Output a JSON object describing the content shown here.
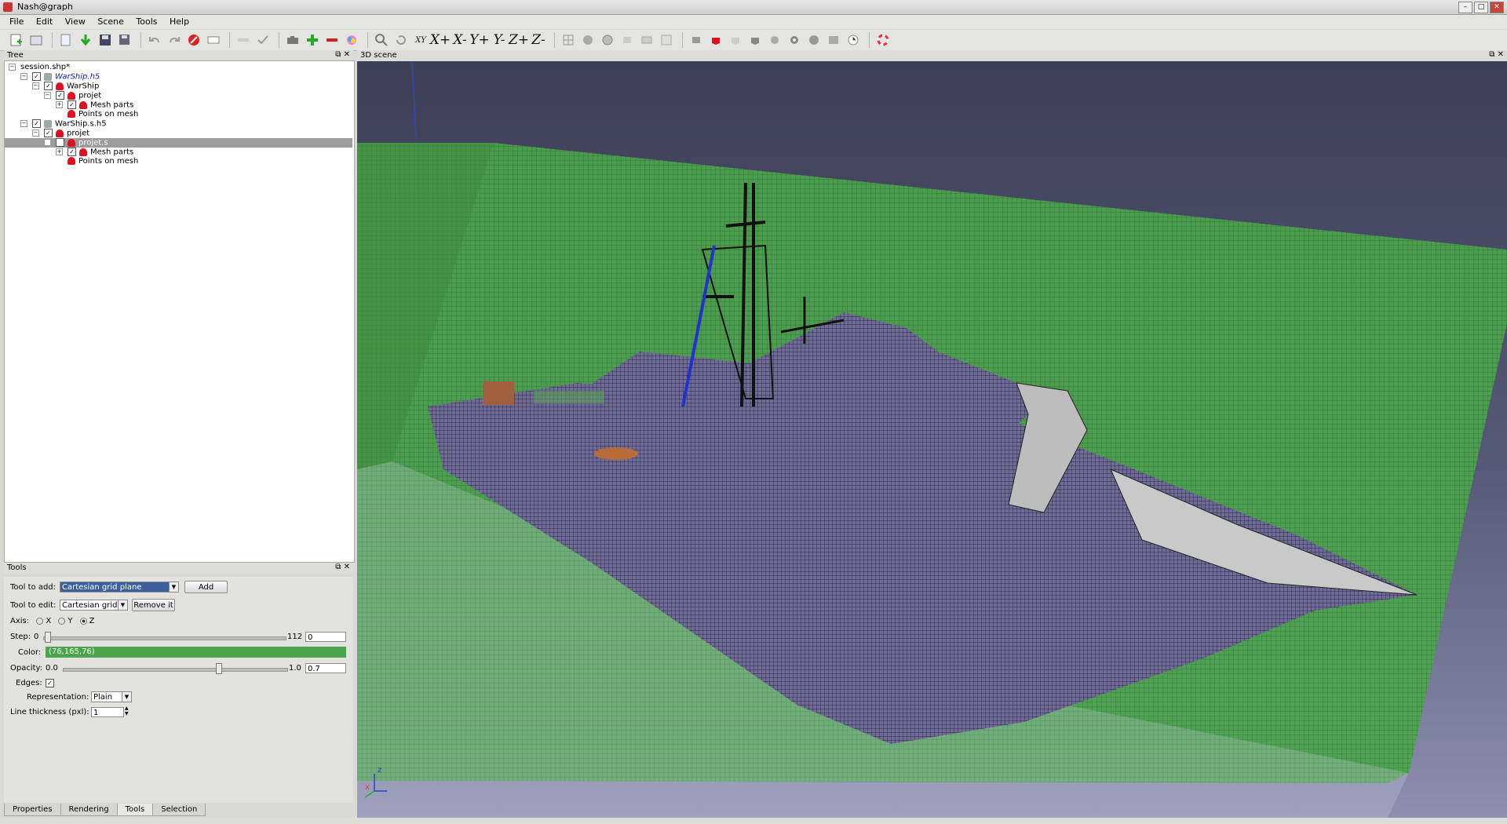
{
  "window": {
    "title": "Nash@graph"
  },
  "menu": [
    "File",
    "Edit",
    "View",
    "Scene",
    "Tools",
    "Help"
  ],
  "toolbar": {
    "axis_buttons": [
      "X+",
      "X-",
      "Y+",
      "Y-",
      "Z+",
      "Z-"
    ],
    "axis_label_xy": "XY"
  },
  "tree_panel": {
    "title": "Tree",
    "items": [
      {
        "label": "session.shp*"
      },
      {
        "label": "WarShip.h5"
      },
      {
        "label": "WarShip"
      },
      {
        "label": "projet"
      },
      {
        "label": "Mesh parts"
      },
      {
        "label": "Points on mesh"
      },
      {
        "label": "WarShip.s.h5"
      },
      {
        "label": "projet"
      },
      {
        "label": "projet.s"
      },
      {
        "label": "Mesh parts"
      },
      {
        "label": "Points on mesh"
      }
    ]
  },
  "tools_panel": {
    "title": "Tools",
    "tool_to_add_label": "Tool to add:",
    "tool_to_add_value": "Cartesian grid plane",
    "add_button": "Add",
    "tool_to_edit_label": "Tool to edit:",
    "tool_to_edit_value": "Cartesian grid",
    "remove_button": "Remove it",
    "axis_label": "Axis:",
    "axis_options": [
      "X",
      "Y",
      "Z"
    ],
    "axis_selected": "Z",
    "step_label": "Step:",
    "step_min": "0",
    "step_max": "112",
    "step_value": "0",
    "color_label": "Color:",
    "color_value": "(76,165,76)",
    "color_hex": "#4ca54c",
    "opacity_label": "Opacity:",
    "opacity_min": "0.0",
    "opacity_max": "1.0",
    "opacity_value": "0.7",
    "edges_label": "Edges:",
    "edges_checked": true,
    "representation_label": "Representation:",
    "representation_value": "Plain",
    "line_thickness_label": "Line thickness (pxl):",
    "line_thickness_value": "1"
  },
  "bottom_tabs": [
    "Properties",
    "Rendering",
    "Tools",
    "Selection"
  ],
  "active_tab": "Tools",
  "scene_panel": {
    "title": "3D scene",
    "axis_x": "x",
    "axis_z": "z"
  }
}
